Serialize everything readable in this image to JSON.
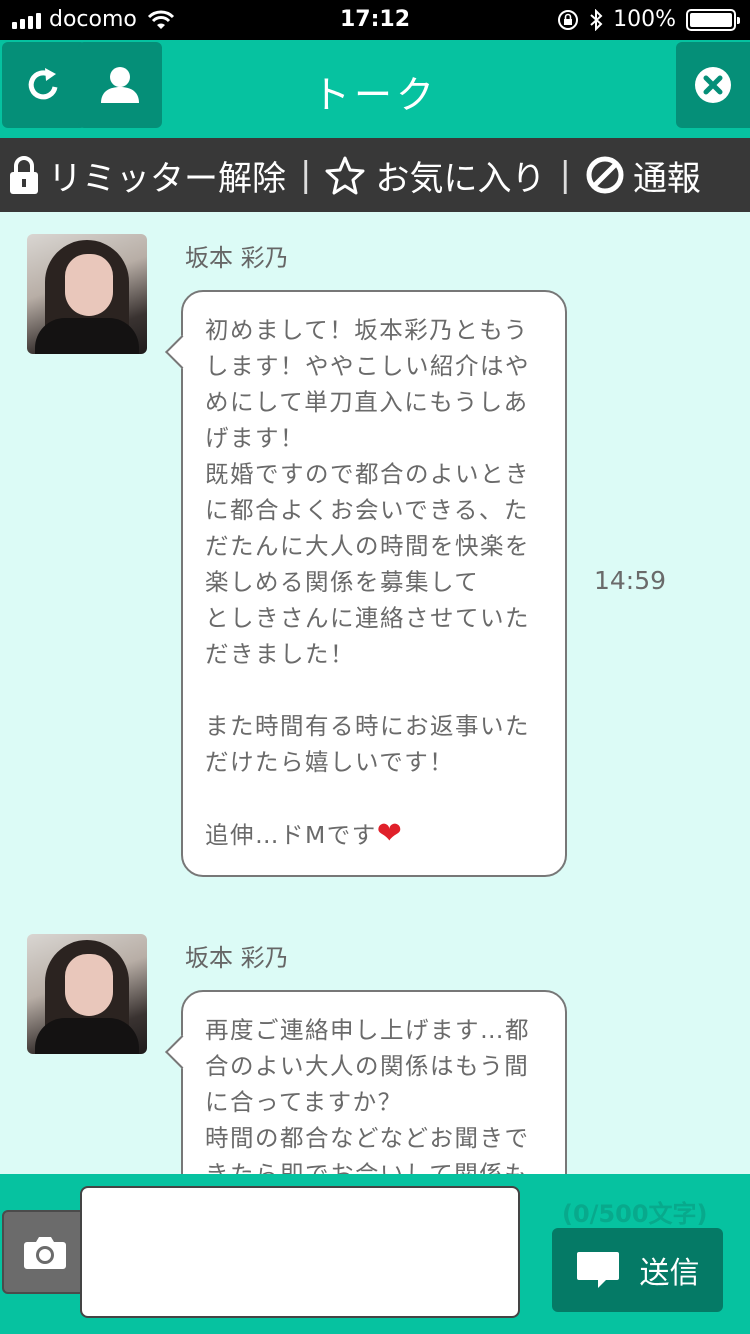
{
  "status_bar": {
    "carrier": "docomo",
    "time": "17:12",
    "battery": "100%",
    "battery_level": 1.0
  },
  "header": {
    "title": "トーク",
    "icons": [
      "reload-icon",
      "profile-icon",
      "close-icon"
    ]
  },
  "actions": {
    "limiter": "リミッター解除",
    "favorite": "お気に入り",
    "report": "通報",
    "separator": "|"
  },
  "messages": [
    {
      "sender": "坂本 彩乃",
      "time": "14:59",
      "lines": [
        "初めまして！坂本彩乃ともう",
        "します！ややこしい紹介はや",
        "めにして単刀直入にもうしあ",
        "げます！",
        "既婚ですので都合のよいとき",
        "に都合よくお会いできる、た",
        "だたんに大人の時間を快楽を",
        "楽しめる関係を募集して",
        "としきさんに連絡させていた",
        "だきました！",
        "",
        "また時間有る時にお返事いた",
        "だけたら嬉しいです！",
        ""
      ],
      "last_line": "追伸…ドMです",
      "last_emoji": "❤"
    },
    {
      "sender": "坂本 彩乃",
      "lines": [
        "再度ご連絡申し上げます…都",
        "合のよい大人の関係はもう間",
        "に合ってますか？",
        "時間の都合などなどお聞きで",
        "きたら即でお会いして関係も"
      ]
    }
  ],
  "footer": {
    "input_value": "",
    "counter": "(0/500文字)",
    "send_label": "送信"
  },
  "colors": {
    "accent": "#06c2a0",
    "accent_dark": "#058f78",
    "action_bar": "#383838",
    "chat_bg": "#dcfbf6",
    "heart": "#e0202a"
  }
}
